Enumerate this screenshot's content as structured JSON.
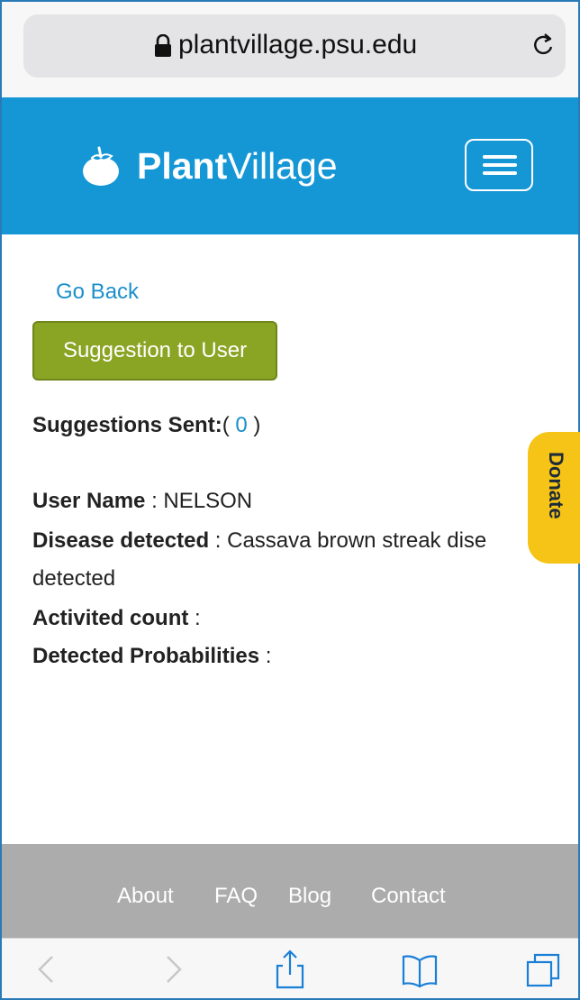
{
  "browser": {
    "url": "plantvillage.psu.edu",
    "icons": [
      "lock-icon",
      "reload-icon",
      "back-icon",
      "forward-icon",
      "share-icon",
      "bookmarks-icon",
      "tabs-icon"
    ]
  },
  "header": {
    "logo_bold": "Plant",
    "logo_light": "Village",
    "logo_icon": "tomato-icon",
    "menu_icon": "hamburger-icon"
  },
  "content": {
    "go_back": "Go Back",
    "suggestion_button": "Suggestion to User",
    "suggestions_sent_label": "Suggestions Sent:",
    "suggestions_open": "( ",
    "suggestions_count": "0",
    "suggestions_close": " )",
    "user_name_label": "User Name",
    "user_name_value": " : NELSON",
    "disease_label": "Disease detected",
    "disease_value": " : Cassava brown streak dise",
    "disease_value_cont": "detected",
    "activited_label": "Activited count",
    "activited_value": " :",
    "probabilities_label": "Detected Probabilities",
    "probabilities_value": " :"
  },
  "donate": {
    "label": "Donate"
  },
  "footer": {
    "links": [
      "About",
      "FAQ",
      "Blog",
      "Contact"
    ]
  },
  "colors": {
    "header_blue": "#1597d6",
    "button_green": "#8aa424",
    "donate_yellow": "#f6c417",
    "footer_gray": "#acacac",
    "link_blue": "#1b8fcc"
  }
}
